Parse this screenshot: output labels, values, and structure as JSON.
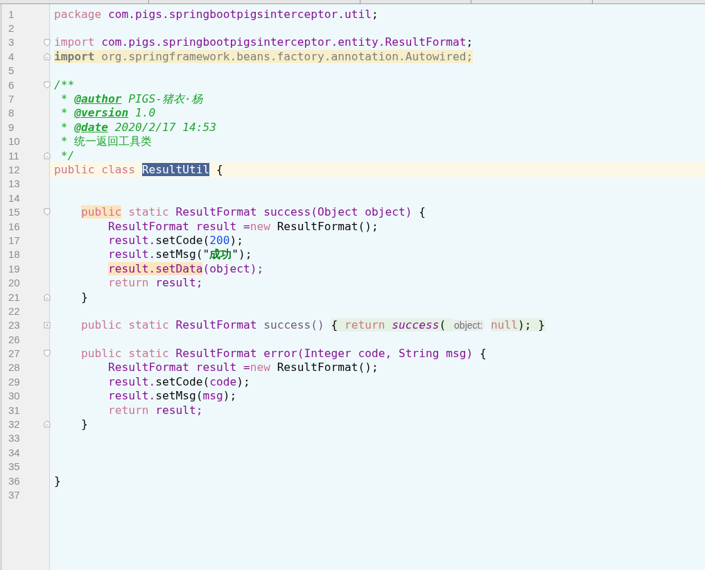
{
  "editor": {
    "lines": [
      {
        "number": "1",
        "tokens": [
          {
            "text": "package ",
            "kind": "keyword"
          },
          {
            "text": "com.pigs.springbootpigsinterceptor.util",
            "kind": "ident"
          },
          {
            "text": ";",
            "kind": "plain"
          }
        ]
      },
      {
        "number": "2"
      },
      {
        "number": "3",
        "fold_start": true,
        "tokens": [
          {
            "text": "import ",
            "kind": "keyword"
          },
          {
            "text": "com.pigs.springbootpigsinterceptor.entity.ResultFormat",
            "kind": "ident"
          },
          {
            "text": ";",
            "kind": "plain"
          }
        ]
      },
      {
        "number": "4",
        "fold_end": true,
        "tokens": [
          {
            "text": "import",
            "kind": "unused-keyword"
          },
          {
            "text": " org.springframework.beans.factory.annotation.Autowired;",
            "kind": "unused"
          }
        ]
      },
      {
        "number": "5"
      },
      {
        "number": "6",
        "fold_start": true,
        "tokens": [
          {
            "text": "/**",
            "kind": "comment"
          }
        ]
      },
      {
        "number": "7",
        "tokens": [
          {
            "text": " * ",
            "kind": "comment"
          },
          {
            "text": "@author",
            "kind": "doctag"
          },
          {
            "text": " PIGS-猪衣·杨",
            "kind": "comment"
          }
        ]
      },
      {
        "number": "8",
        "tokens": [
          {
            "text": " * ",
            "kind": "comment"
          },
          {
            "text": "@version",
            "kind": "doctag"
          },
          {
            "text": " 1.0",
            "kind": "comment"
          }
        ]
      },
      {
        "number": "9",
        "tokens": [
          {
            "text": " * ",
            "kind": "comment"
          },
          {
            "text": "@date",
            "kind": "doctag"
          },
          {
            "text": " 2020/2/17 14:53",
            "kind": "comment"
          }
        ]
      },
      {
        "number": "10",
        "tokens": [
          {
            "text": " * 统一返回工具类",
            "kind": "comment-plain"
          }
        ]
      },
      {
        "number": "11",
        "fold_end": true,
        "tokens": [
          {
            "text": " */",
            "kind": "comment"
          }
        ]
      },
      {
        "number": "12",
        "current": true,
        "tokens": [
          {
            "text": "public class ",
            "kind": "keyword"
          },
          {
            "text": "ResultUtil",
            "kind": "plain",
            "selected": true
          },
          {
            "text": " {",
            "kind": "plain"
          }
        ]
      },
      {
        "number": "13"
      },
      {
        "number": "14"
      },
      {
        "number": "15",
        "fold_start": true,
        "tokens": [
          {
            "text": "    public",
            "kind": "keyword",
            "highlighted": true
          },
          {
            "text": " static ",
            "kind": "keyword"
          },
          {
            "text": "ResultFormat success(Object object) ",
            "kind": "ident"
          },
          {
            "text": "{",
            "kind": "plain"
          }
        ]
      },
      {
        "number": "16",
        "tokens": [
          {
            "text": "        ResultFormat result =",
            "kind": "ident"
          },
          {
            "text": "new ",
            "kind": "keyword"
          },
          {
            "text": "ResultFormat();",
            "kind": "plain"
          }
        ]
      },
      {
        "number": "17",
        "tokens": [
          {
            "text": "        result.",
            "kind": "ident"
          },
          {
            "text": "setCode(",
            "kind": "plain"
          },
          {
            "text": "200",
            "kind": "number"
          },
          {
            "text": ");",
            "kind": "plain"
          }
        ]
      },
      {
        "number": "18",
        "tokens": [
          {
            "text": "        result.",
            "kind": "ident"
          },
          {
            "text": "setMsg(\"",
            "kind": "plain"
          },
          {
            "text": "成功",
            "kind": "string"
          },
          {
            "text": "\");",
            "kind": "plain"
          }
        ]
      },
      {
        "number": "19",
        "tokens": [
          {
            "text": "        result.setData",
            "kind": "ident",
            "highlighted": true
          },
          {
            "text": "(object);",
            "kind": "ident"
          }
        ]
      },
      {
        "number": "20",
        "tokens": [
          {
            "text": "        return ",
            "kind": "keyword"
          },
          {
            "text": "result;",
            "kind": "ident"
          }
        ]
      },
      {
        "number": "21",
        "fold_end": true,
        "tokens": [
          {
            "text": "    }",
            "kind": "plain"
          }
        ]
      },
      {
        "number": "22"
      },
      {
        "number": "23",
        "collapsed": true,
        "tokens": [
          {
            "text": "    public static ",
            "kind": "keyword"
          },
          {
            "text": "ResultFormat ",
            "kind": "ident"
          },
          {
            "text": "success() ",
            "kind": "muted"
          },
          {
            "text": "{ ",
            "kind": "plain",
            "folded": true
          },
          {
            "text": "return ",
            "kind": "keyword",
            "folded": true
          },
          {
            "text": "success",
            "kind": "static-call",
            "folded": true
          },
          {
            "text": "( ",
            "kind": "plain",
            "folded": true
          },
          {
            "text": "object:",
            "kind": "hint"
          },
          {
            "text": " null",
            "kind": "keyword",
            "folded": true
          },
          {
            "text": "); }",
            "kind": "plain",
            "folded": true
          }
        ]
      },
      {
        "number": "26"
      },
      {
        "number": "27",
        "fold_start": true,
        "tokens": [
          {
            "text": "    public static ",
            "kind": "keyword"
          },
          {
            "text": "ResultFormat error(Integer code, String msg) ",
            "kind": "ident"
          },
          {
            "text": "{",
            "kind": "plain"
          }
        ]
      },
      {
        "number": "28",
        "tokens": [
          {
            "text": "        ResultFormat result =",
            "kind": "ident"
          },
          {
            "text": "new ",
            "kind": "keyword"
          },
          {
            "text": "ResultFormat();",
            "kind": "plain"
          }
        ]
      },
      {
        "number": "29",
        "tokens": [
          {
            "text": "        result.",
            "kind": "ident"
          },
          {
            "text": "setCode(",
            "kind": "plain"
          },
          {
            "text": "code",
            "kind": "ident"
          },
          {
            "text": ");",
            "kind": "plain"
          }
        ]
      },
      {
        "number": "30",
        "tokens": [
          {
            "text": "        result.",
            "kind": "ident"
          },
          {
            "text": "setMsg(",
            "kind": "plain"
          },
          {
            "text": "msg",
            "kind": "ident"
          },
          {
            "text": ");",
            "kind": "plain"
          }
        ]
      },
      {
        "number": "31",
        "tokens": [
          {
            "text": "        return ",
            "kind": "keyword"
          },
          {
            "text": "result;",
            "kind": "ident"
          }
        ]
      },
      {
        "number": "32",
        "fold_end": true,
        "tokens": [
          {
            "text": "    }",
            "kind": "plain"
          }
        ]
      },
      {
        "number": "33"
      },
      {
        "number": "34"
      },
      {
        "number": "35"
      },
      {
        "number": "36",
        "tokens": [
          {
            "text": "}",
            "kind": "plain"
          }
        ]
      },
      {
        "number": "37"
      }
    ]
  }
}
